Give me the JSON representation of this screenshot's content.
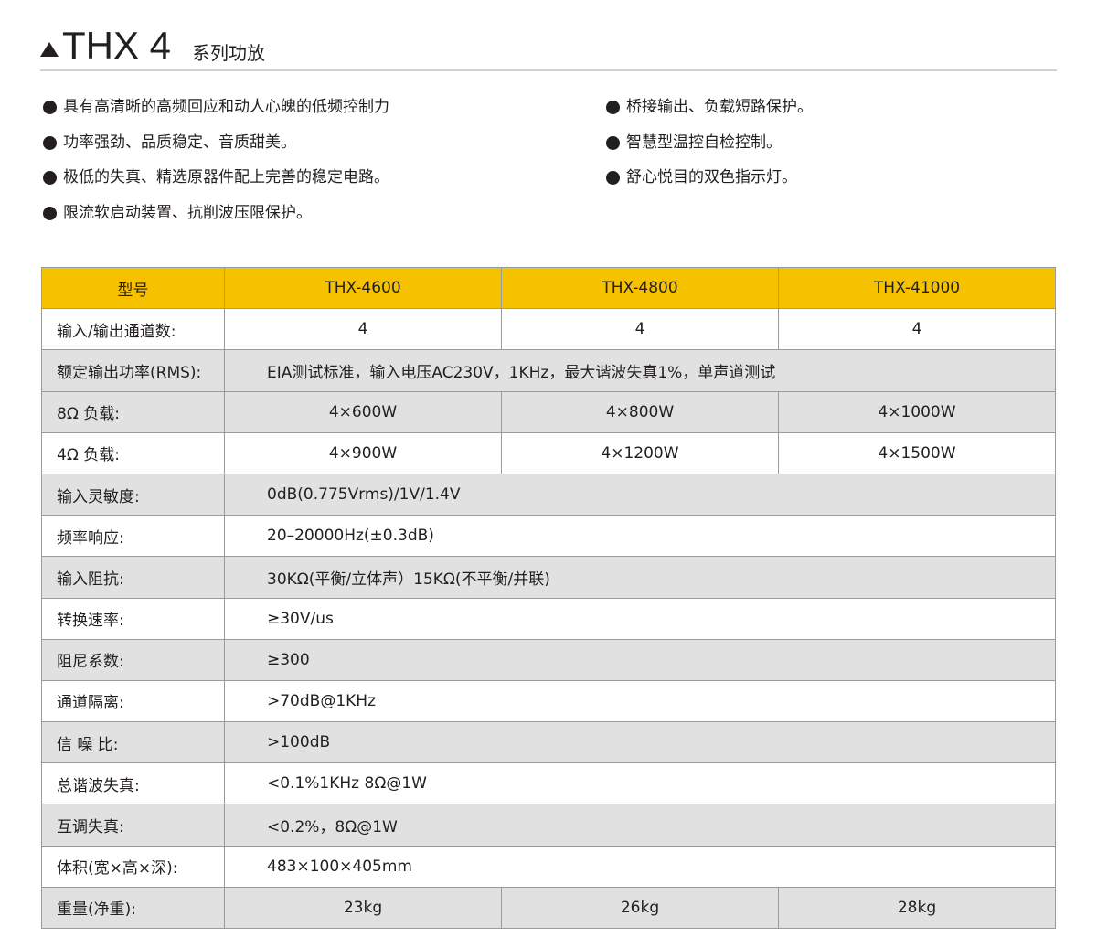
{
  "header": {
    "title_main": "THX 4",
    "title_sub": "系列功放",
    "icon": "triangle-up-icon"
  },
  "features_left": [
    "具有高清晰的高频回应和动人心魄的低频控制力",
    "功率强劲、品质稳定、音质甜美。",
    "极低的失真、精选原器件配上完善的稳定电路。",
    "限流软启动装置、抗削波压限保护。"
  ],
  "features_right": [
    "桥接输出、负载短路保护。",
    "智慧型温控自检控制。",
    "舒心悦目的双色指示灯。"
  ],
  "colors": {
    "header_row": "#f6c200",
    "stripe_gray": "#e1e1e1",
    "border": "#9a9a9a"
  },
  "table": {
    "header": {
      "label": "型号",
      "models": [
        "THX-4600",
        "THX-4800",
        "THX-41000"
      ]
    },
    "rows": [
      {
        "label": "输入/输出通道数:",
        "values": [
          "4",
          "4",
          "4"
        ]
      },
      {
        "label": "额定输出功率(RMS):",
        "span": "EIA测试标准，输入电压AC230V，1KHz，最大谐波失真1%，单声道测试"
      },
      {
        "label": "8Ω 负载:",
        "values": [
          "4×600W",
          "4×800W",
          "4×1000W"
        ]
      },
      {
        "label": "4Ω 负载:",
        "values": [
          "4×900W",
          "4×1200W",
          "4×1500W"
        ]
      },
      {
        "label": "输入灵敏度:",
        "span": "0dB(0.775Vrms)/1V/1.4V"
      },
      {
        "label": "频率响应:",
        "span": "20–20000Hz(±0.3dB)"
      },
      {
        "label": "输入阻抗:",
        "span": "30KΩ(平衡/立体声）15KΩ(不平衡/并联)"
      },
      {
        "label": "转换速率:",
        "span": "≥30V/us"
      },
      {
        "label": "阻尼系数:",
        "span": "≥300"
      },
      {
        "label": "通道隔离:",
        "span": ">70dB@1KHz"
      },
      {
        "label": "信 噪 比:",
        "span": " >100dB"
      },
      {
        "label": "总谐波失真:",
        "span": "<0.1%1KHz 8Ω@1W"
      },
      {
        "label": "互调失真:",
        "span": "<0.2%，8Ω@1W"
      },
      {
        "label": "体积(宽×高×深):",
        "span": "483×100×405mm"
      },
      {
        "label": "重量(净重):",
        "values": [
          "23kg",
          "26kg",
          "28kg"
        ]
      }
    ]
  }
}
